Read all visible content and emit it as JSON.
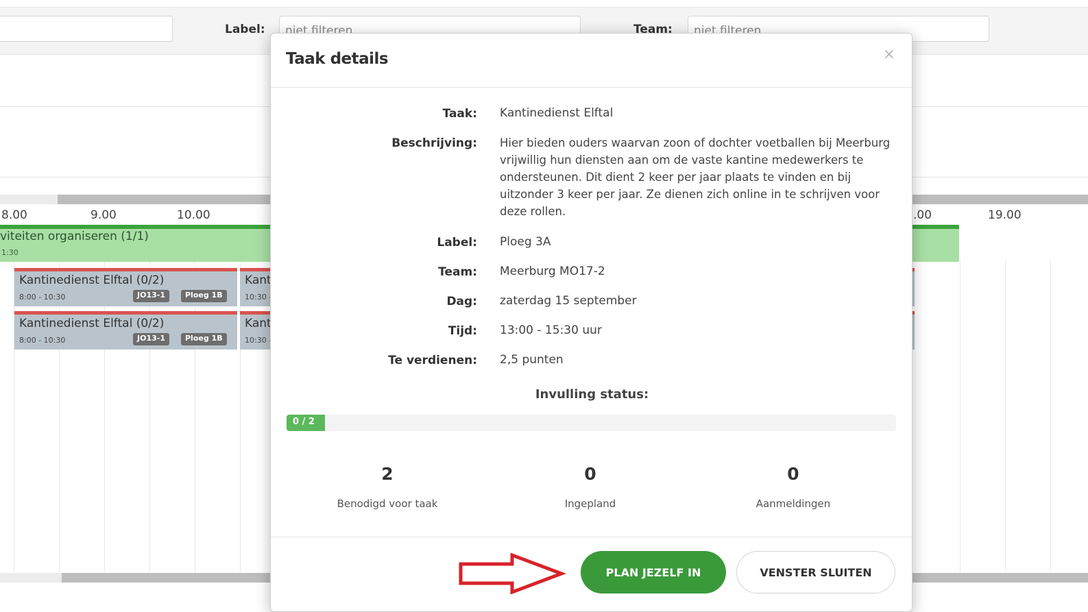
{
  "filters": {
    "first_value": "",
    "label_label": "Label:",
    "label_placeholder": "niet filteren",
    "team_label": "Team:",
    "team_placeholder": "niet filteren"
  },
  "timeline": {
    "hours": [
      "8.00",
      "9.00",
      "10.00",
      ".00",
      "19.00"
    ],
    "activity": {
      "title": "viteiten organiseren (1/1)",
      "time": "1:30"
    },
    "tasks": [
      {
        "title": "Kantinedienst Elftal (0/2)",
        "time": "8:00 - 10:30",
        "badges": [
          "JO13-1",
          "Ploeg 1B"
        ]
      },
      {
        "title": "Kant",
        "time": "10:30 -",
        "badges": []
      },
      {
        "title": "Kantinedienst Elftal (0/2)",
        "time": "8:00 - 10:30",
        "badges": [
          "JO13-1",
          "Ploeg 1B"
        ]
      },
      {
        "title": "Kant",
        "time": "10:30 -",
        "badges": []
      }
    ]
  },
  "modal": {
    "title": "Taak details",
    "close_symbol": "×",
    "details": [
      {
        "label": "Taak:",
        "value": "Kantinedienst Elftal"
      },
      {
        "label": "Beschrijving:",
        "value": "Hier bieden ouders waarvan zoon of dochter voetballen bij Meerburg vrijwillig hun diensten aan om de vaste kantine medewerkers te ondersteunen. Dit dient 2 keer per jaar plaats te vinden en bij uitzonder 3 keer per jaar. Ze dienen zich online in te schrijven voor deze rollen."
      },
      {
        "label": "Label:",
        "value": "Ploeg 3A"
      },
      {
        "label": "Team:",
        "value": "Meerburg MO17-2"
      },
      {
        "label": "Dag:",
        "value": "zaterdag 15 september"
      },
      {
        "label": "Tijd:",
        "value": "13:00 - 15:30 uur"
      },
      {
        "label": "Te verdienen:",
        "value": "2,5 punten"
      }
    ],
    "status_title": "Invulling status:",
    "progress": {
      "text": "0 / 2",
      "filled": 0,
      "total": 2
    },
    "stats": [
      {
        "value": "2",
        "label": "Benodigd voor taak"
      },
      {
        "value": "0",
        "label": "Ingepland"
      },
      {
        "value": "0",
        "label": "Aanmeldingen"
      }
    ],
    "buttons": {
      "plan": "PLAN JEZELF IN",
      "close": "VENSTER SLUITEN"
    }
  },
  "colors": {
    "primary_green": "#3a9a3a",
    "progress_green": "#5cb85c",
    "band_green": "#a8dfa4",
    "task_red": "#d9534f",
    "arrow_red": "#d8232a"
  }
}
